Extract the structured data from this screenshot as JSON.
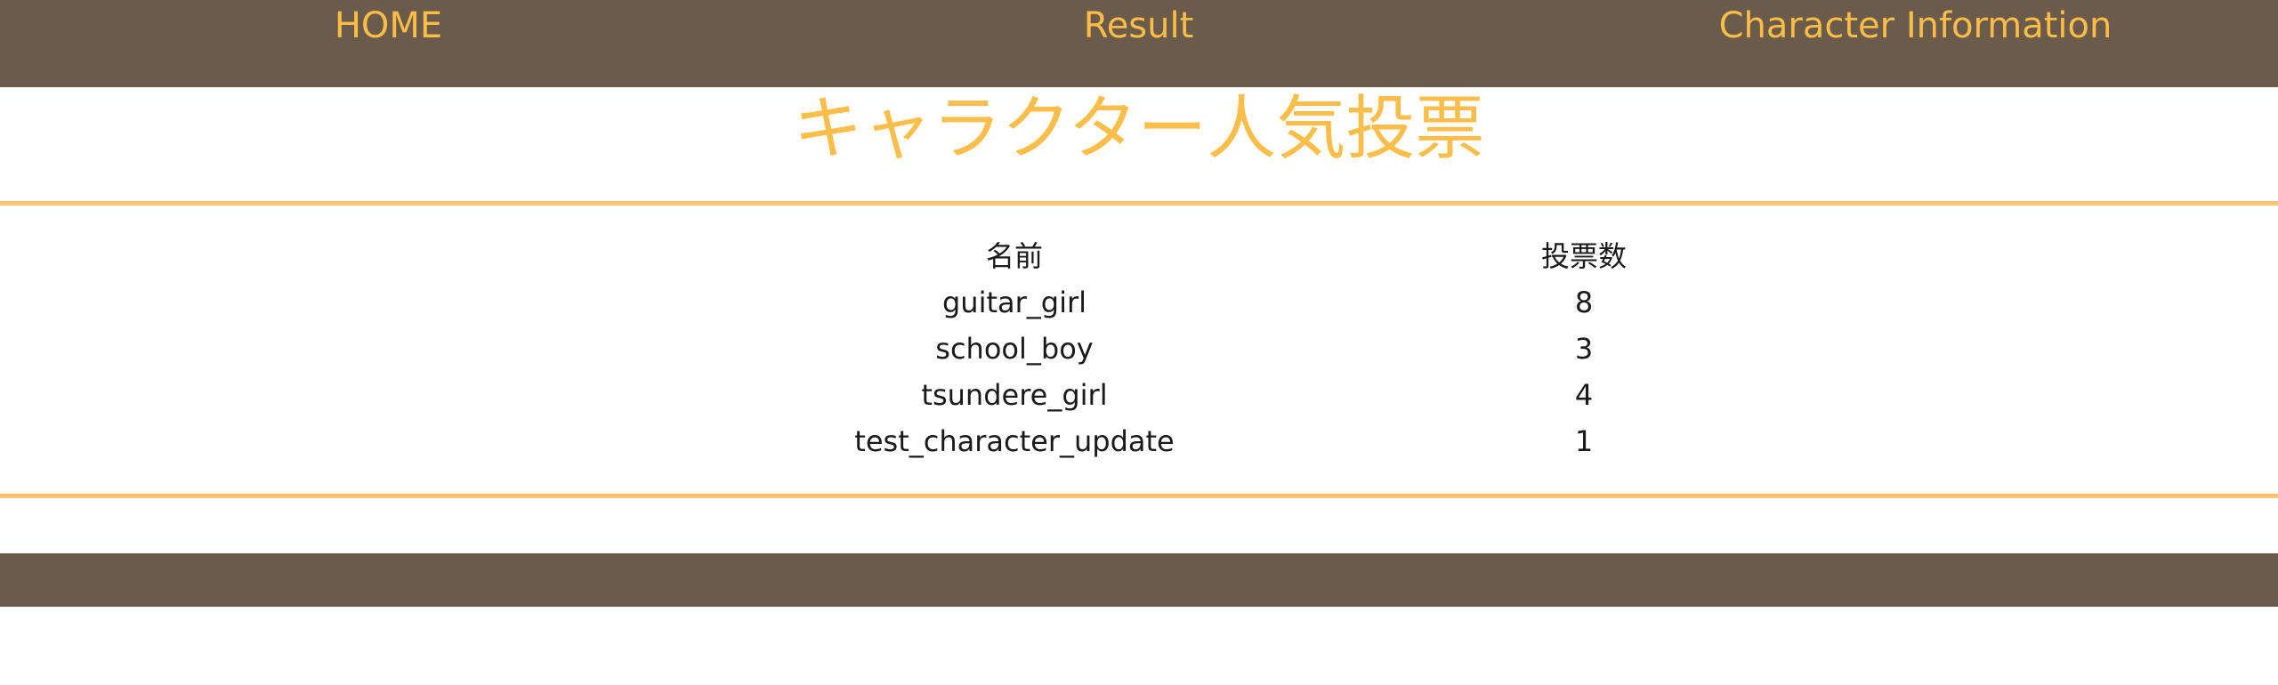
{
  "nav": {
    "items": [
      {
        "label": "HOME"
      },
      {
        "label": "Result"
      },
      {
        "label": "Character Information"
      }
    ]
  },
  "page": {
    "title": "キャラクター人気投票"
  },
  "results": {
    "headers": {
      "name": "名前",
      "votes": "投票数"
    },
    "rows": [
      {
        "name": "guitar_girl",
        "votes": "8"
      },
      {
        "name": "school_boy",
        "votes": "3"
      },
      {
        "name": "tsundere_girl",
        "votes": "4"
      },
      {
        "name": "test_character_update",
        "votes": "1"
      }
    ]
  },
  "colors": {
    "nav_background": "#6b5b4b",
    "accent": "#fcbe4b",
    "rule": "#ffc470",
    "text": "#1a1a1a"
  }
}
